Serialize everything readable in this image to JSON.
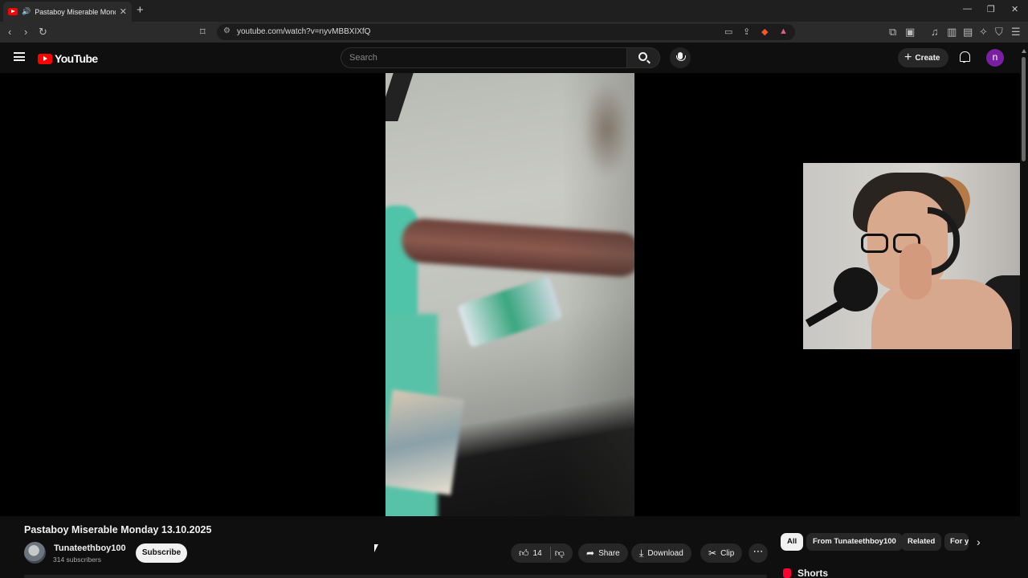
{
  "browser": {
    "tab_title": "Pastaboy Miserable Monday",
    "url": "youtube.com/watch?v=nyvMBBXIXfQ",
    "new_tab": "+",
    "tab_close": "✕",
    "window_minimize": "—",
    "window_restore": "❐",
    "window_close": "✕"
  },
  "masthead": {
    "logo_text": "YouTube",
    "search_placeholder": "Search",
    "create_label": "Create",
    "avatar_letter": "n"
  },
  "video": {
    "title": "Pastaboy Miserable Monday 13.10.2025",
    "channel_name": "Tunateethboy100",
    "subscriber_count": "314 subscribers",
    "subscribe_label": "Subscribe",
    "like_count": "14",
    "share_label": "Share",
    "download_label": "Download",
    "clip_label": "Clip"
  },
  "chips": {
    "items": [
      {
        "label": "All",
        "active": true
      },
      {
        "label": "From Tunateethboy100",
        "active": false
      },
      {
        "label": "Related",
        "active": false
      },
      {
        "label": "For you",
        "active": false
      }
    ]
  },
  "sidebar": {
    "shorts_label": "Shorts"
  },
  "colors": {
    "background": "#0f0f0f",
    "brand_red": "#ff0000",
    "avatar_purple": "#7b1fa2"
  }
}
